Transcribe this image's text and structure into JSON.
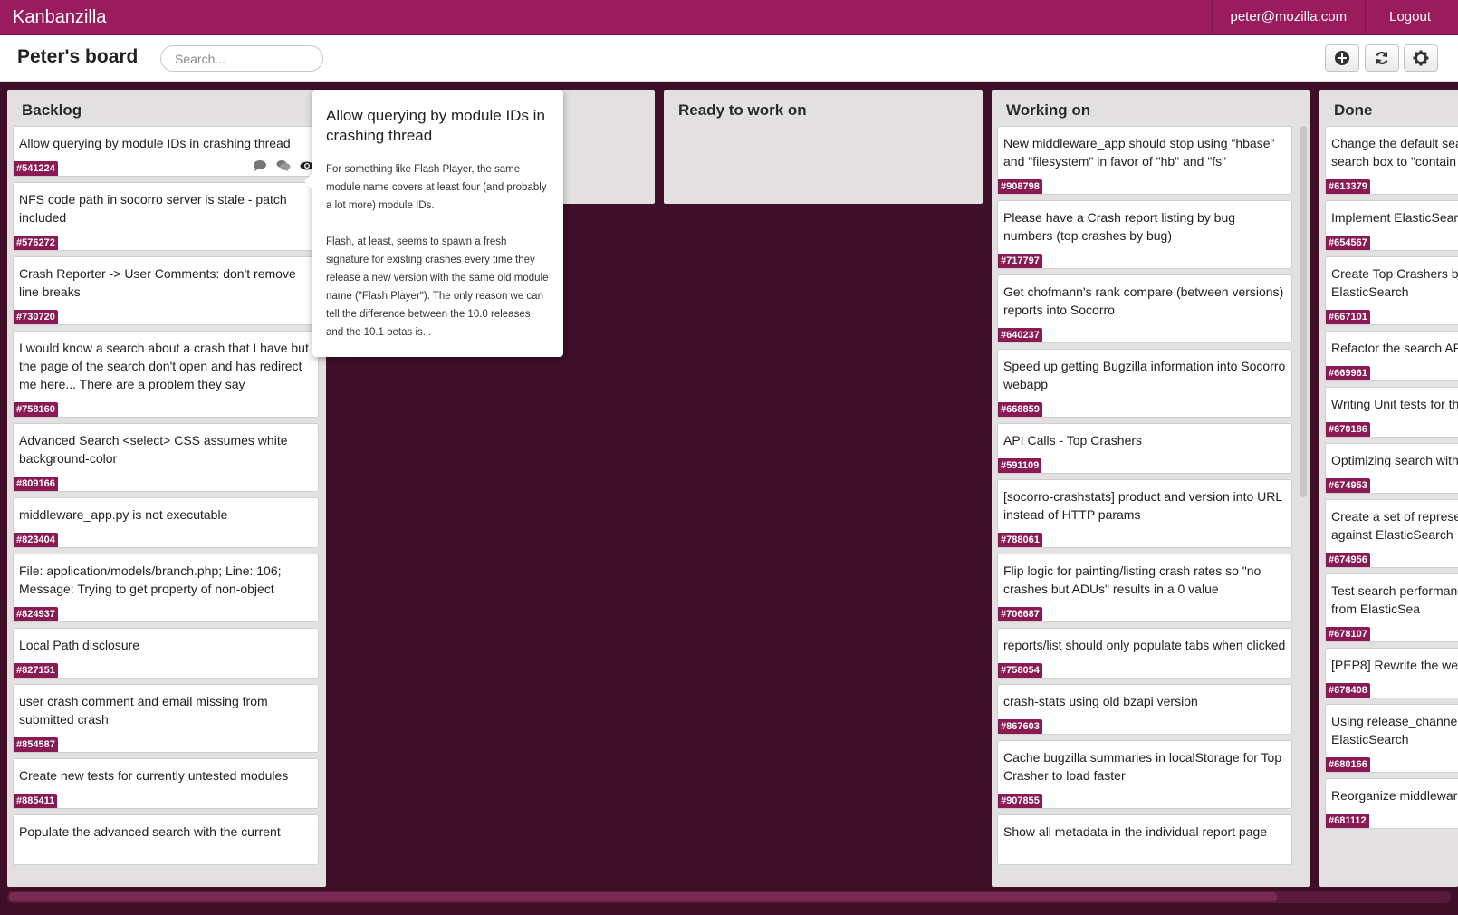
{
  "app": {
    "brand": "Kanbanzilla",
    "user_email": "peter@mozilla.com",
    "logout_label": "Logout"
  },
  "header": {
    "board_title": "Peter's board",
    "search_placeholder": "Search...",
    "buttons": [
      "add-icon",
      "refresh-icon",
      "settings-icon"
    ]
  },
  "columns": [
    {
      "title": "Backlog",
      "cards": [
        {
          "title": "Allow querying by module IDs in crashing thread",
          "id": "#541224"
        },
        {
          "title": "NFS code path in socorro server is stale - patch included",
          "id": "#576272"
        },
        {
          "title": "Crash Reporter -> User Comments: don't remove line breaks",
          "id": "#730720"
        },
        {
          "title": "I would know a search about a crash that I have but the page of the search don't open and has redirect me here... There are a problem they say",
          "id": "#758160"
        },
        {
          "title": "Advanced Search <select> CSS assumes white background-color",
          "id": "#809166"
        },
        {
          "title": "middleware_app.py is not executable",
          "id": "#823404"
        },
        {
          "title": "File: application/models/branch.php; Line: 106; Message: Trying to get property of non-object",
          "id": "#824937"
        },
        {
          "title": "Local Path disclosure",
          "id": "#827151"
        },
        {
          "title": "user crash comment and email missing from submitted crash",
          "id": "#854587"
        },
        {
          "title": "Create new tests for currently untested modules",
          "id": "#885411"
        },
        {
          "title": "Populate the advanced search with the current",
          "id": ""
        }
      ]
    },
    {
      "title": "",
      "cards": []
    },
    {
      "title": "Ready to work on",
      "cards": []
    },
    {
      "title": "Working on",
      "cards": [
        {
          "title": "New middleware_app should stop using \"hbase\" and \"filesystem\" in favor of \"hb\" and \"fs\"",
          "id": "#908798"
        },
        {
          "title": "Please have a Crash report listing by bug numbers (top crashes by bug)",
          "id": "#717797"
        },
        {
          "title": "Get chofmann's rank compare (between versions) reports into Socorro",
          "id": "#640237"
        },
        {
          "title": "Speed up getting Bugzilla information into Socorro webapp",
          "id": "#668859"
        },
        {
          "title": "API Calls - Top Crashers",
          "id": "#591109"
        },
        {
          "title": "[socorro-crashstats] product and version into URL instead of HTTP params",
          "id": "#788061"
        },
        {
          "title": "Flip logic for painting/listing crash rates so \"no crashes but ADUs\" results in a 0 value",
          "id": "#706687"
        },
        {
          "title": "reports/list should only populate tabs when clicked",
          "id": "#758054"
        },
        {
          "title": "crash-stats using old bzapi version",
          "id": "#867603"
        },
        {
          "title": "Cache bugzilla summaries in localStorage for Top Crasher to load faster",
          "id": "#907855"
        },
        {
          "title": "Show all metadata in the individual report page",
          "id": ""
        }
      ]
    },
    {
      "title": "Done",
      "cards": [
        {
          "title": "Change the default sea search box to \"contain",
          "id": "#613379"
        },
        {
          "title": "Implement ElasticSearc",
          "id": "#654567"
        },
        {
          "title": "Create Top Crashers by using ElasticSearch",
          "id": "#667101"
        },
        {
          "title": "Refactor the search AP",
          "id": "#669961"
        },
        {
          "title": "Writing Unit tests for th",
          "id": "#670186"
        },
        {
          "title": "Optimizing search with",
          "id": "#674953"
        },
        {
          "title": "Create a set of represe against ElasticSearch",
          "id": "#674956"
        },
        {
          "title": "Test search performan results from ElasticSea",
          "id": "#678107"
        },
        {
          "title": "[PEP8] Rewrite the we",
          "id": "#678408"
        },
        {
          "title": "Using release_channel ElasticSearch",
          "id": "#680166"
        },
        {
          "title": "Reorganize middleware",
          "id": "#681112"
        }
      ]
    }
  ],
  "popover": {
    "title": "Allow querying by module IDs in crashing thread",
    "body": "For something like Flash Player, the same module name covers at least four (and probably a lot more) module IDs.\n\nFlash, at least, seems to spawn a fresh signature for existing crashes every time they release a new version with the same old module name (\"Flash Player\"). The only reason we can tell the difference between the 10.0 releases and the 10.1 betas is..."
  },
  "colors": {
    "brand": "#9a1c5c",
    "background": "#3e0f27",
    "badge": "#8a1a53",
    "column": "#e3e0e1"
  }
}
